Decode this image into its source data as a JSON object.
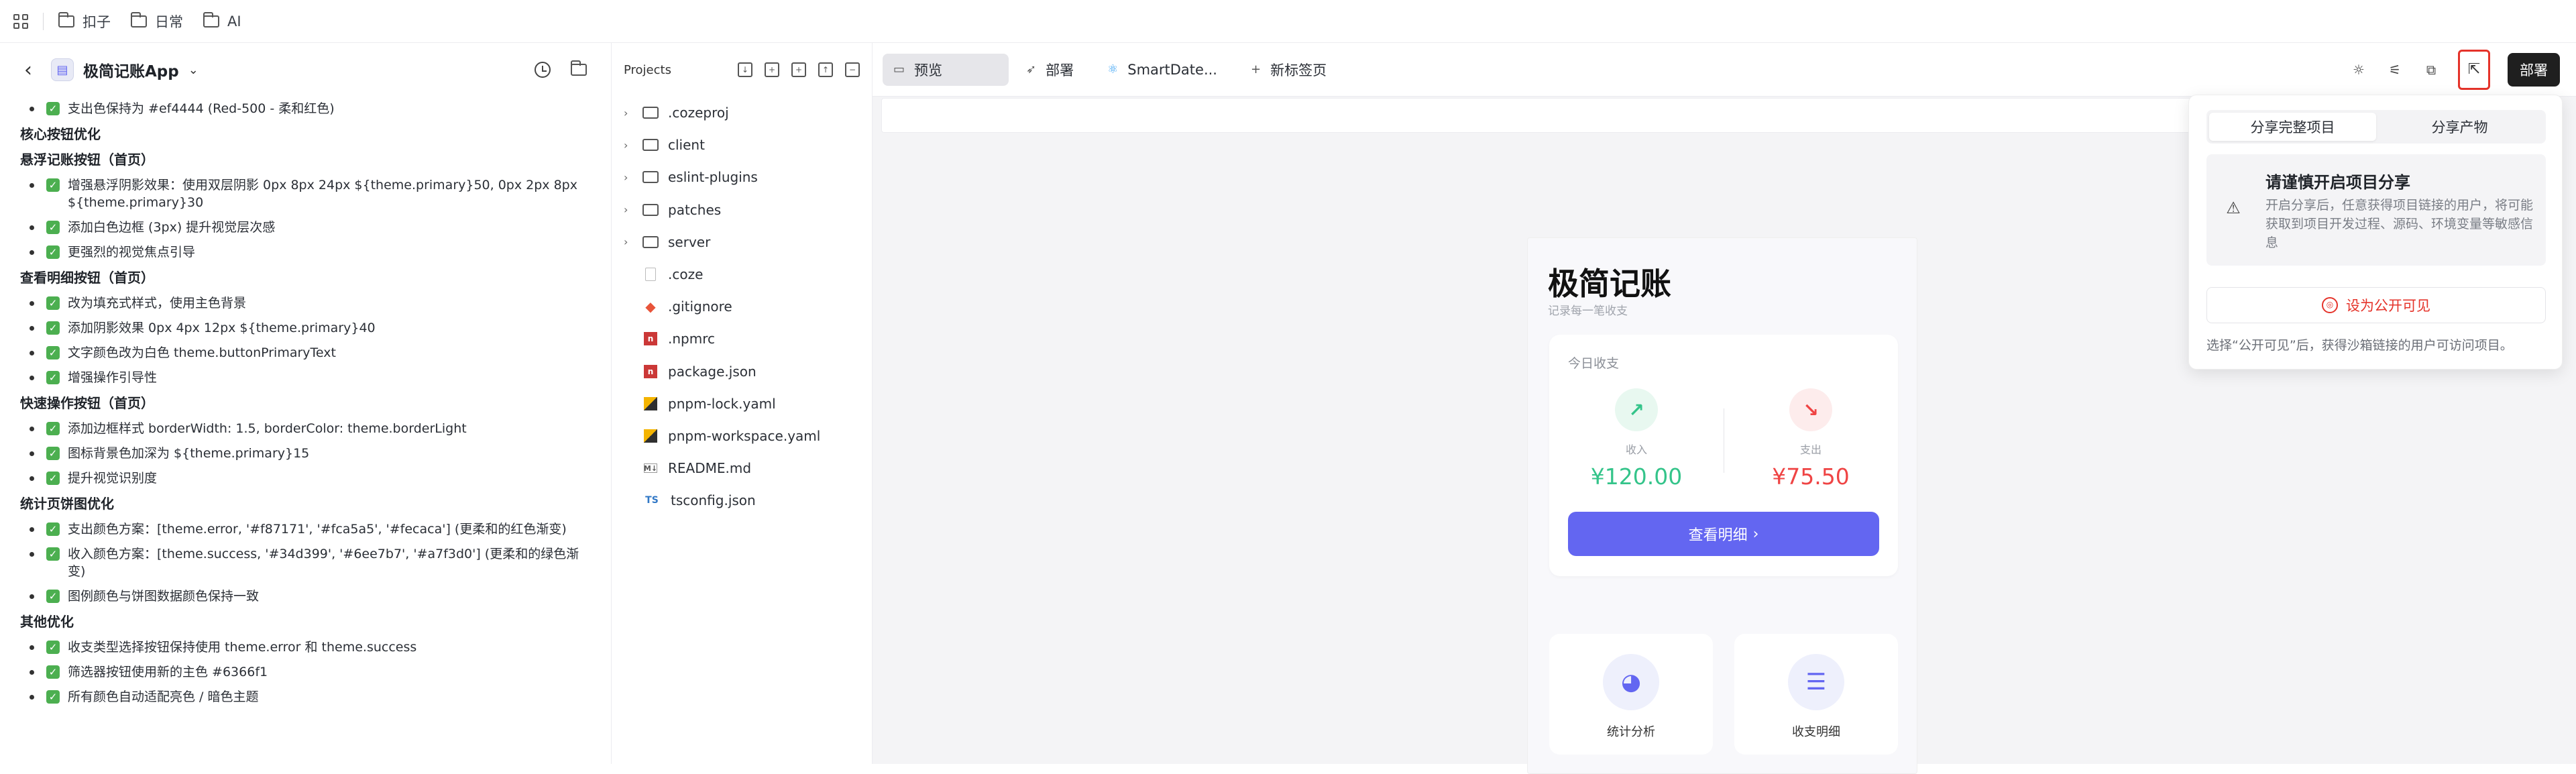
{
  "topbar": {
    "breadcrumbs": [
      "扣子",
      "日常",
      "AI"
    ]
  },
  "chat": {
    "app_name": "极简记账App",
    "first_item": "支出色保持为 #ef4444 (Red-500 - 柔和红色)",
    "sections": [
      {
        "title": "核心按钮优化",
        "items": []
      },
      {
        "title": "悬浮记账按钮（首页）",
        "items": [
          "增强悬浮阴影效果：使用双层阴影 0px 8px 24px ${theme.primary}50, 0px 2px 8px ${theme.primary}30",
          "添加白色边框 (3px) 提升视觉层次感",
          "更强烈的视觉焦点引导"
        ]
      },
      {
        "title": "查看明细按钮（首页）",
        "items": [
          "改为填充式样式，使用主色背景",
          "添加阴影效果 0px 4px 12px ${theme.primary}40",
          "文字颜色改为白色 theme.buttonPrimaryText",
          "增强操作引导性"
        ]
      },
      {
        "title": "快速操作按钮（首页）",
        "items": [
          "添加边框样式 borderWidth: 1.5, borderColor: theme.borderLight",
          "图标背景色加深为 ${theme.primary}15",
          "提升视觉识别度"
        ]
      },
      {
        "title": "统计页饼图优化",
        "items": [
          "支出颜色方案：[theme.error, '#f87171', '#fca5a5', '#fecaca'] (更柔和的红色渐变)",
          "收入颜色方案：[theme.success, '#34d399', '#6ee7b7', '#a7f3d0'] (更柔和的绿色渐变)",
          "图例颜色与饼图数据颜色保持一致"
        ]
      },
      {
        "title": "其他优化",
        "items": [
          "收支类型选择按钮保持使用 theme.error 和 theme.success",
          "筛选器按钮使用新的主色 #6366f1",
          "所有颜色自动适配亮色 / 暗色主题"
        ]
      }
    ]
  },
  "filetree": {
    "title": "Projects",
    "items": [
      {
        "name": ".cozeproj",
        "type": "folder"
      },
      {
        "name": "client",
        "type": "folder"
      },
      {
        "name": "eslint-plugins",
        "type": "folder"
      },
      {
        "name": "patches",
        "type": "folder"
      },
      {
        "name": "server",
        "type": "folder"
      },
      {
        "name": ".coze",
        "type": "file"
      },
      {
        "name": ".gitignore",
        "type": "git"
      },
      {
        "name": ".npmrc",
        "type": "npm"
      },
      {
        "name": "package.json",
        "type": "npm"
      },
      {
        "name": "pnpm-lock.yaml",
        "type": "yaml"
      },
      {
        "name": "pnpm-workspace.yaml",
        "type": "yaml"
      },
      {
        "name": "README.md",
        "type": "md"
      },
      {
        "name": "tsconfig.json",
        "type": "ts"
      }
    ]
  },
  "tabs": {
    "preview": "预览",
    "deploy": "部署",
    "smartdate": "SmartDate...",
    "new_tab": "新标签页",
    "deploy_button": "部署"
  },
  "phone": {
    "title": "极简记账",
    "subtitle": "记录每一笔收支",
    "today_label": "今日收支",
    "income_label": "收入",
    "income_value": "¥120.00",
    "expense_label": "支出",
    "expense_value": "¥75.50",
    "detail_button": "查看明细",
    "stats_label": "统计分析",
    "list_label": "收支明细",
    "colors": {
      "primary": "#6366f1",
      "income": "#34c48a",
      "expense": "#ef4444"
    }
  },
  "share": {
    "tab_project": "分享完整项目",
    "tab_artifact": "分享产物",
    "warn_title": "请谨慎开启项目分享",
    "warn_desc": "开启分享后，任意获得项目链接的用户，将可能获取到项目开发过程、源码、环境变量等敏感信息",
    "public_button": "设为公开可见",
    "note": "选择“公开可见”后，获得沙箱链接的用户可访问项目。"
  }
}
